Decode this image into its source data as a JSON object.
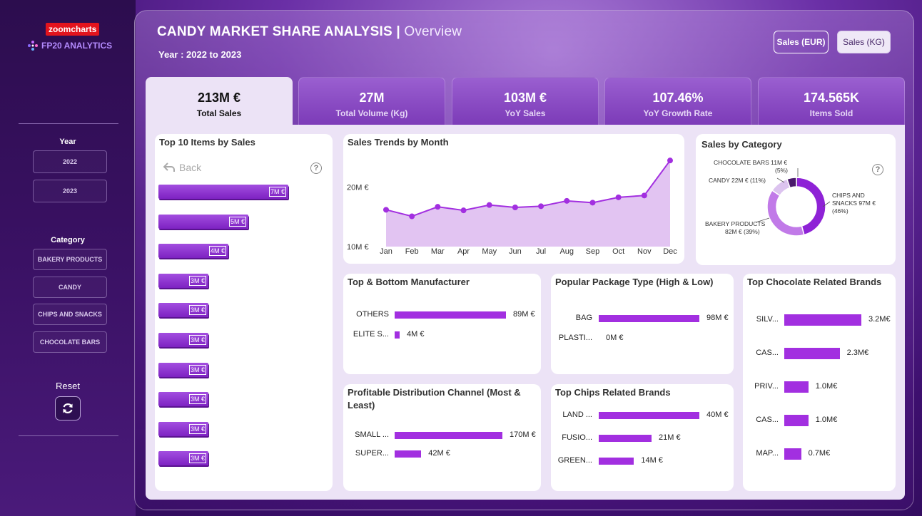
{
  "sidebar": {
    "logo_zoom": "zoomcharts",
    "logo_fp": "FP20 ANALYTICS",
    "year_title": "Year",
    "years": [
      "2022",
      "2023"
    ],
    "category_title": "Category",
    "categories": [
      "BAKERY PRODUCTS",
      "CANDY",
      "CHIPS AND SNACKS",
      "CHOCOLATE BARS"
    ],
    "reset_label": "Reset"
  },
  "header": {
    "title": "CANDY MARKET SHARE ANALYSIS",
    "separator": "|",
    "subtitle": "Overview",
    "year_range": "Year : 2022 to 2023",
    "unit_eur": "Sales (EUR)",
    "unit_kg": "Sales (KG)"
  },
  "kpis": [
    {
      "value": "213M €",
      "label": "Total Sales"
    },
    {
      "value": "27M",
      "label": "Total Volume (Kg)"
    },
    {
      "value": "103M €",
      "label": "YoY Sales"
    },
    {
      "value": "107.46%",
      "label": "YoY Growth Rate"
    },
    {
      "value": "174.565K",
      "label": "Items Sold"
    }
  ],
  "top10": {
    "title": "Top 10 Items by Sales",
    "back_label": "Back",
    "help": "?",
    "labels": [
      "7M €",
      "5M €",
      "4M €",
      "3M €",
      "3M €",
      "3M €",
      "3M €",
      "3M €",
      "3M €",
      "3M €"
    ]
  },
  "trend": {
    "title": "Sales Trends by Month",
    "y_ticks": [
      "20M €",
      "10M €"
    ],
    "months": [
      "Jan",
      "Feb",
      "Mar",
      "Apr",
      "May",
      "Jun",
      "Jul",
      "Aug",
      "Sep",
      "Oct",
      "Nov",
      "Dec"
    ]
  },
  "category_donut": {
    "title": "Sales by Category",
    "help": "?",
    "labels": {
      "chocolate": "CHOCOLATE BARS 11M €",
      "chocolate_pct": "(5%)",
      "candy": "CANDY 22M € (11%)",
      "chips": "CHIPS AND",
      "chips2": "SNACKS 97M €",
      "chips_pct": "(46%)",
      "bakery": "BAKERY PRODUCTS",
      "bakery2": "82M € (39%)"
    }
  },
  "manufacturer": {
    "title": "Top & Bottom Manufacturer",
    "rows": [
      {
        "label": "OTHERS",
        "value": "89M €"
      },
      {
        "label": "ELITE S...",
        "value": "4M €"
      }
    ]
  },
  "package": {
    "title": "Popular Package Type (High & Low)",
    "rows": [
      {
        "label": "BAG",
        "value": "98M €"
      },
      {
        "label": "PLASTI...",
        "value": "0M €"
      }
    ]
  },
  "choco_brands": {
    "title": "Top Chocolate Related Brands",
    "rows": [
      {
        "label": "SILV...",
        "value": "3.2M€"
      },
      {
        "label": "CAS...",
        "value": "2.3M€"
      },
      {
        "label": "PRIV...",
        "value": "1.0M€"
      },
      {
        "label": "CAS...",
        "value": "1.0M€"
      },
      {
        "label": "MAP...",
        "value": "0.7M€"
      }
    ]
  },
  "channel": {
    "title": "Profitable Distribution Channel (Most &",
    "title2": "Least)",
    "rows": [
      {
        "label": "SMALL ...",
        "value": "170M €"
      },
      {
        "label": "SUPER...",
        "value": "42M €"
      }
    ]
  },
  "chips_brands": {
    "title": "Top Chips Related Brands",
    "rows": [
      {
        "label": "LAND ...",
        "value": "40M €"
      },
      {
        "label": "FUSIO...",
        "value": "21M €"
      },
      {
        "label": "GREEN...",
        "value": "14M €"
      }
    ]
  },
  "colors": {
    "accent": "#a22fe0",
    "kpi_active": "#ece3f6",
    "panel": "#ece3f6"
  },
  "chart_data": [
    {
      "type": "bar",
      "title": "Top 10 Items by Sales",
      "categories": [
        "1",
        "2",
        "3",
        "4",
        "5",
        "6",
        "7",
        "8",
        "9",
        "10"
      ],
      "values": [
        7,
        5,
        4,
        3,
        3,
        3,
        3,
        3,
        3,
        3
      ]
    },
    {
      "type": "area",
      "title": "Sales Trends by Month",
      "x": [
        "Jan",
        "Feb",
        "Mar",
        "Apr",
        "May",
        "Jun",
        "Jul",
        "Aug",
        "Sep",
        "Oct",
        "Nov",
        "Dec"
      ],
      "y": [
        16.2,
        15.1,
        16.7,
        16.1,
        17.0,
        16.6,
        16.8,
        17.7,
        17.4,
        18.3,
        18.6,
        24.5
      ],
      "ylim": [
        10,
        25
      ]
    },
    {
      "type": "pie",
      "title": "Sales by Category",
      "categories": [
        "CHIPS AND SNACKS",
        "BAKERY PRODUCTS",
        "CANDY",
        "CHOCOLATE BARS"
      ],
      "values": [
        97,
        82,
        22,
        11
      ]
    },
    {
      "type": "bar",
      "title": "Top & Bottom Manufacturer",
      "categories": [
        "OTHERS",
        "ELITE S..."
      ],
      "values": [
        89,
        4
      ]
    },
    {
      "type": "bar",
      "title": "Popular Package Type (High & Low)",
      "categories": [
        "BAG",
        "PLASTI..."
      ],
      "values": [
        98,
        0
      ]
    },
    {
      "type": "bar",
      "title": "Top Chocolate Related Brands",
      "categories": [
        "SILV...",
        "CAS...",
        "PRIV...",
        "CAS...",
        "MAP..."
      ],
      "values": [
        3.2,
        2.3,
        1.0,
        1.0,
        0.7
      ]
    },
    {
      "type": "bar",
      "title": "Profitable Distribution Channel (Most & Least)",
      "categories": [
        "SMALL ...",
        "SUPER..."
      ],
      "values": [
        170,
        42
      ]
    },
    {
      "type": "bar",
      "title": "Top Chips Related Brands",
      "categories": [
        "LAND ...",
        "FUSIO...",
        "GREEN..."
      ],
      "values": [
        40,
        21,
        14
      ]
    }
  ]
}
